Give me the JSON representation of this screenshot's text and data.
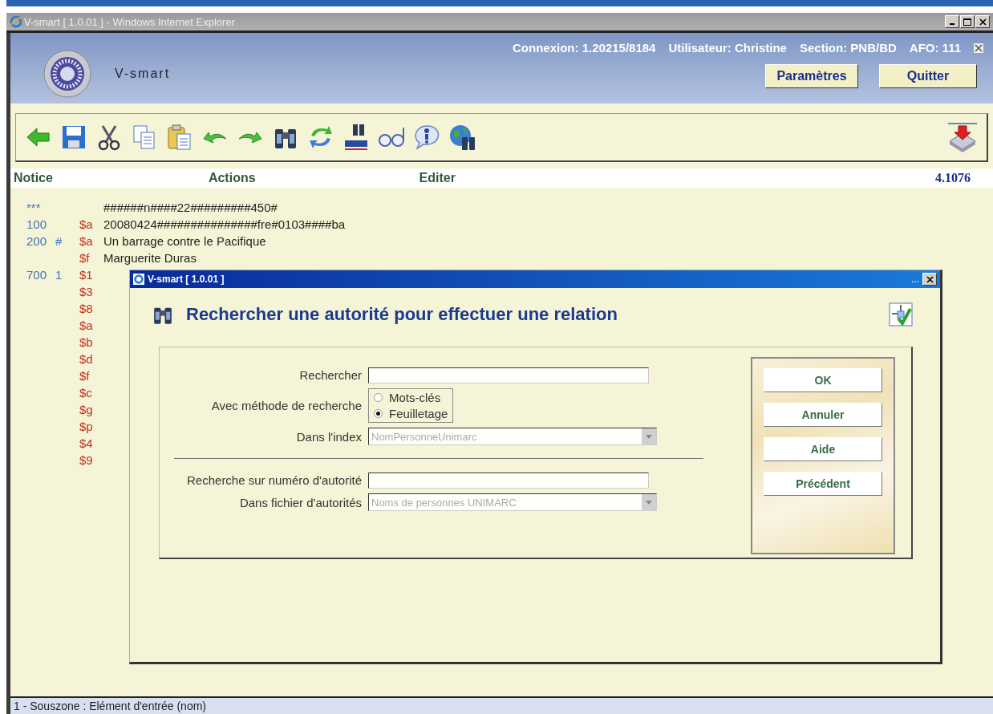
{
  "window": {
    "title": "V-smart [ 1.0.01 ] - Windows Internet Explorer"
  },
  "header": {
    "logo_text": "V-smart",
    "session": [
      "Connexion: 1.20215/8184",
      "Utilisateur: Christine",
      "Section: PNB/BD",
      "AFO: 111"
    ],
    "buttons": [
      "Paramètres",
      "Quitter"
    ]
  },
  "menu": {
    "items": [
      "Notice",
      "Actions",
      "Editer"
    ],
    "code": "4.1076"
  },
  "records": [
    {
      "tag": "***",
      "value": "######n####22#########450#"
    },
    {
      "tag": "100",
      "sub": "$a",
      "value": "20080424###############fre#0103####ba"
    },
    {
      "tag": "200",
      "ind": "#",
      "sub": "$a",
      "value": "Un barrage contre le Pacifique"
    },
    {
      "sub": "$f",
      "value": "Marguerite Duras"
    },
    {
      "tag": "700",
      "ind": "1",
      "sub": "$1"
    },
    {
      "sub": "$3"
    },
    {
      "sub": "$8"
    },
    {
      "sub": "$a"
    },
    {
      "sub": "$b"
    },
    {
      "sub": "$d"
    },
    {
      "sub": "$f"
    },
    {
      "sub": "$c"
    },
    {
      "sub": "$g"
    },
    {
      "sub": "$p"
    },
    {
      "sub": "$4"
    },
    {
      "sub": "$9"
    }
  ],
  "dialog": {
    "title": "V-smart [ 1.0.01 ]",
    "title_dots": "...",
    "heading": "Rechercher une autorité pour effectuer une relation",
    "search_label": "Rechercher",
    "method_label": "Avec méthode de recherche",
    "methods": [
      {
        "label": "Mots-clés",
        "selected": false
      },
      {
        "label": "Feuilletage",
        "selected": true
      }
    ],
    "index_label": "Dans l'index",
    "index_value": "NomPersonneUnimarc",
    "number_label": "Recherche sur numéro d'autorité",
    "file_label": "Dans fichier d'autorités",
    "file_value": "Noms de personnes UNIMARC",
    "buttons": [
      "OK",
      "Annuler",
      "Aide",
      "Précédent"
    ]
  },
  "status_bar": "1 - Souszone : Elément d'entrée (nom)"
}
